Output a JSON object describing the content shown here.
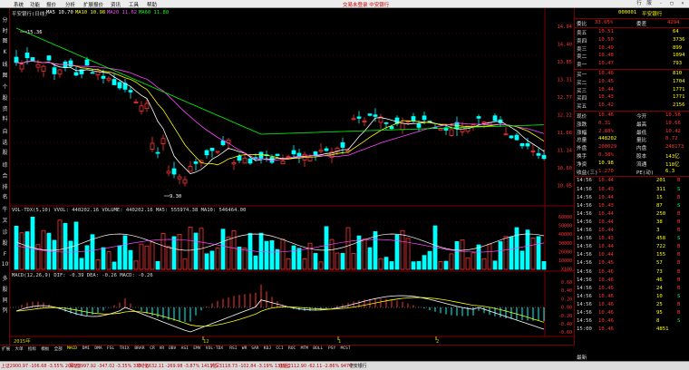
{
  "menu": {
    "items": [
      "系统",
      "功能",
      "报价",
      "分析",
      "扩展报价",
      "资讯",
      "工具",
      "帮助"
    ],
    "ticker": "交易未登录   中安银行",
    "window_buttons": [
      "行",
      "服",
      "-",
      "□",
      "×"
    ]
  },
  "leftbar": {
    "labels": [
      "分",
      "时",
      "图",
      "K",
      "线",
      "图",
      "个",
      "股",
      "资",
      "料",
      "自",
      "选",
      "股",
      "综",
      "合",
      "排",
      "名",
      "牛",
      "叉",
      "诊",
      "股",
      "F",
      "10",
      "多",
      "股",
      "同",
      "列"
    ]
  },
  "chart": {
    "stock_label": "平安银行(日线)",
    "ma_labels": [
      {
        "text": "MA5 10.70",
        "color": "#ffffff"
      },
      {
        "text": "MA10 10.98",
        "color": "#ffff00"
      },
      {
        "text": "MA20 11.62",
        "color": "#ff44ff"
      },
      {
        "text": "MA60 11.80",
        "color": "#00ff00"
      }
    ],
    "high_mark": "15.36",
    "low_mark": "9.30",
    "price_axis": [
      "14.94",
      "14.40",
      "13.85",
      "13.31",
      "12.77",
      "12.22",
      "11.68",
      "11.14",
      "10.60",
      "10.05"
    ],
    "volume_line": "VOL-TDX(5,10)  VVOL: 440202.16  VOLUME: 440202.16  MA5: 555974.38  MA10: 546464.00",
    "volume_axis": [
      "60000",
      "50000",
      "40000",
      "30000",
      "20000",
      "10000",
      "X100"
    ],
    "macd_line": "MACD(12,26,9)  DIF: -0.39  DEA: -0.26  MACD: -0.26",
    "macd_axis": [
      "0.60",
      "0.40",
      "0.20",
      "0.00",
      "-0.20",
      "-0.40",
      "-0.60"
    ],
    "x_labels": [
      "2015年",
      "12",
      "1",
      "2"
    ]
  },
  "tabs": [
    "扩展",
    "大单",
    "指标",
    "模板",
    "全部",
    "MACD",
    "DMI",
    "DMA",
    "FSL",
    "TRIX",
    "BRAR",
    "CR",
    "VR",
    "OBV",
    "ASI",
    "EMV",
    "VOL-TDX",
    "RSI",
    "WR",
    "SAR",
    "KDJ",
    "CCI",
    "ROC",
    "MTM",
    "BOLL",
    "PSY",
    "MCST"
  ],
  "quote": {
    "code": "000001",
    "name": "平安银行",
    "weibi_label": "委比",
    "weibi_val": "33.65%",
    "weicha_label": "委差",
    "weicha_val": "4294",
    "asks": [
      {
        "label": "卖五",
        "price": "10.51",
        "vol": "64"
      },
      {
        "label": "卖四",
        "price": "10.50",
        "vol": "3736"
      },
      {
        "label": "卖三",
        "price": "10.49",
        "vol": "899"
      },
      {
        "label": "卖二",
        "price": "10.48",
        "vol": "1094"
      },
      {
        "label": "卖一",
        "price": "10.47",
        "vol": "793"
      }
    ],
    "bids": [
      {
        "label": "买一",
        "price": "10.46",
        "vol": "810"
      },
      {
        "label": "买二",
        "price": "10.45",
        "vol": "1704"
      },
      {
        "label": "买三",
        "price": "10.44",
        "vol": "1771"
      },
      {
        "label": "买四",
        "price": "10.43",
        "vol": "1771"
      },
      {
        "label": "买五",
        "price": "10.42",
        "vol": "2156"
      }
    ],
    "stats": [
      {
        "l1": "现价",
        "v1": "10.46",
        "l2": "今开",
        "v2": "10.56"
      },
      {
        "l1": "涨跌",
        "v1": "0.31",
        "l2": "最高",
        "v2": "10.66"
      },
      {
        "l1": "涨幅",
        "v1": "2.88%",
        "l2": "最低",
        "v2": "10.42"
      },
      {
        "l1": "总量",
        "v1": "448202",
        "l2": "量比",
        "v2": "0.72"
      },
      {
        "l1": "外盘",
        "v1": "200029",
        "l2": "内盘",
        "v2": "248173"
      },
      {
        "l1": "换手",
        "v1": "0.38%",
        "l2": "股本",
        "v2": "143亿"
      },
      {
        "l1": "净资",
        "v1": "10.98",
        "l2": "流通",
        "v2": "118亿"
      },
      {
        "l1": "收益(三)",
        "v1": "1.270",
        "l2": "PE(动)",
        "v2": "6.3"
      }
    ],
    "ticks": [
      {
        "time": "14:56",
        "price": "10.44",
        "vol": "201",
        "dir": "B"
      },
      {
        "time": "14:56",
        "price": "10.43",
        "vol": "311",
        "dir": "S"
      },
      {
        "time": "14:56",
        "price": "10.44",
        "vol": "15",
        "dir": "B"
      },
      {
        "time": "14:56",
        "price": "10.43",
        "vol": "87",
        "dir": "S"
      },
      {
        "time": "14:56",
        "price": "10.44",
        "vol": "250",
        "dir": "B"
      },
      {
        "time": "14:56",
        "price": "10.44",
        "vol": "38",
        "dir": "B"
      },
      {
        "time": "14:56",
        "price": "10.44",
        "vol": "3",
        "dir": "B"
      },
      {
        "time": "14:56",
        "price": "10.43",
        "vol": "458",
        "dir": "S"
      },
      {
        "time": "14:56",
        "price": "10.44",
        "vol": "722",
        "dir": "B"
      },
      {
        "time": "14:56",
        "price": "10.44",
        "vol": "155",
        "dir": "B"
      },
      {
        "time": "14:56",
        "price": "10.45",
        "vol": "57",
        "dir": "B"
      },
      {
        "time": "14:56",
        "price": "10.46",
        "vol": "73",
        "dir": "B"
      },
      {
        "time": "14:56",
        "price": "10.46",
        "vol": "46",
        "dir": "B"
      },
      {
        "time": "14:56",
        "price": "10.46",
        "vol": "24",
        "dir": "B"
      },
      {
        "time": "14:56",
        "price": "10.46",
        "vol": "10",
        "dir": "S"
      },
      {
        "time": "14:56",
        "price": "10.46",
        "vol": "25",
        "dir": "B"
      },
      {
        "time": "14:56",
        "price": "10.46",
        "vol": "95",
        "dir": "B"
      },
      {
        "time": "14:56",
        "price": "10.46",
        "vol": "8",
        "dir": "S"
      },
      {
        "time": "15:00",
        "price": "10.46",
        "vol": "4851",
        "dir": ""
      }
    ],
    "foot_label": "最新"
  },
  "status": [
    {
      "text": "上证2900.97  -106.68  -3.55%  2065亿",
      "color": "#c00000"
    },
    {
      "text": "深证9997.92  -347.02  -3.35%  3337亿",
      "color": "#c00000"
    },
    {
      "text": "中小6632.11  -269.98  -3.87%  1413亿",
      "color": "#c00000"
    },
    {
      "text": "沪深3118.73  -102.84  -3.19%  1319亿",
      "color": "#c00000"
    },
    {
      "text": "创业2112.90  -62.11  -2.86%  947亿",
      "color": "#c00000"
    },
    {
      "text": "中安银行",
      "color": "#000000"
    }
  ]
}
